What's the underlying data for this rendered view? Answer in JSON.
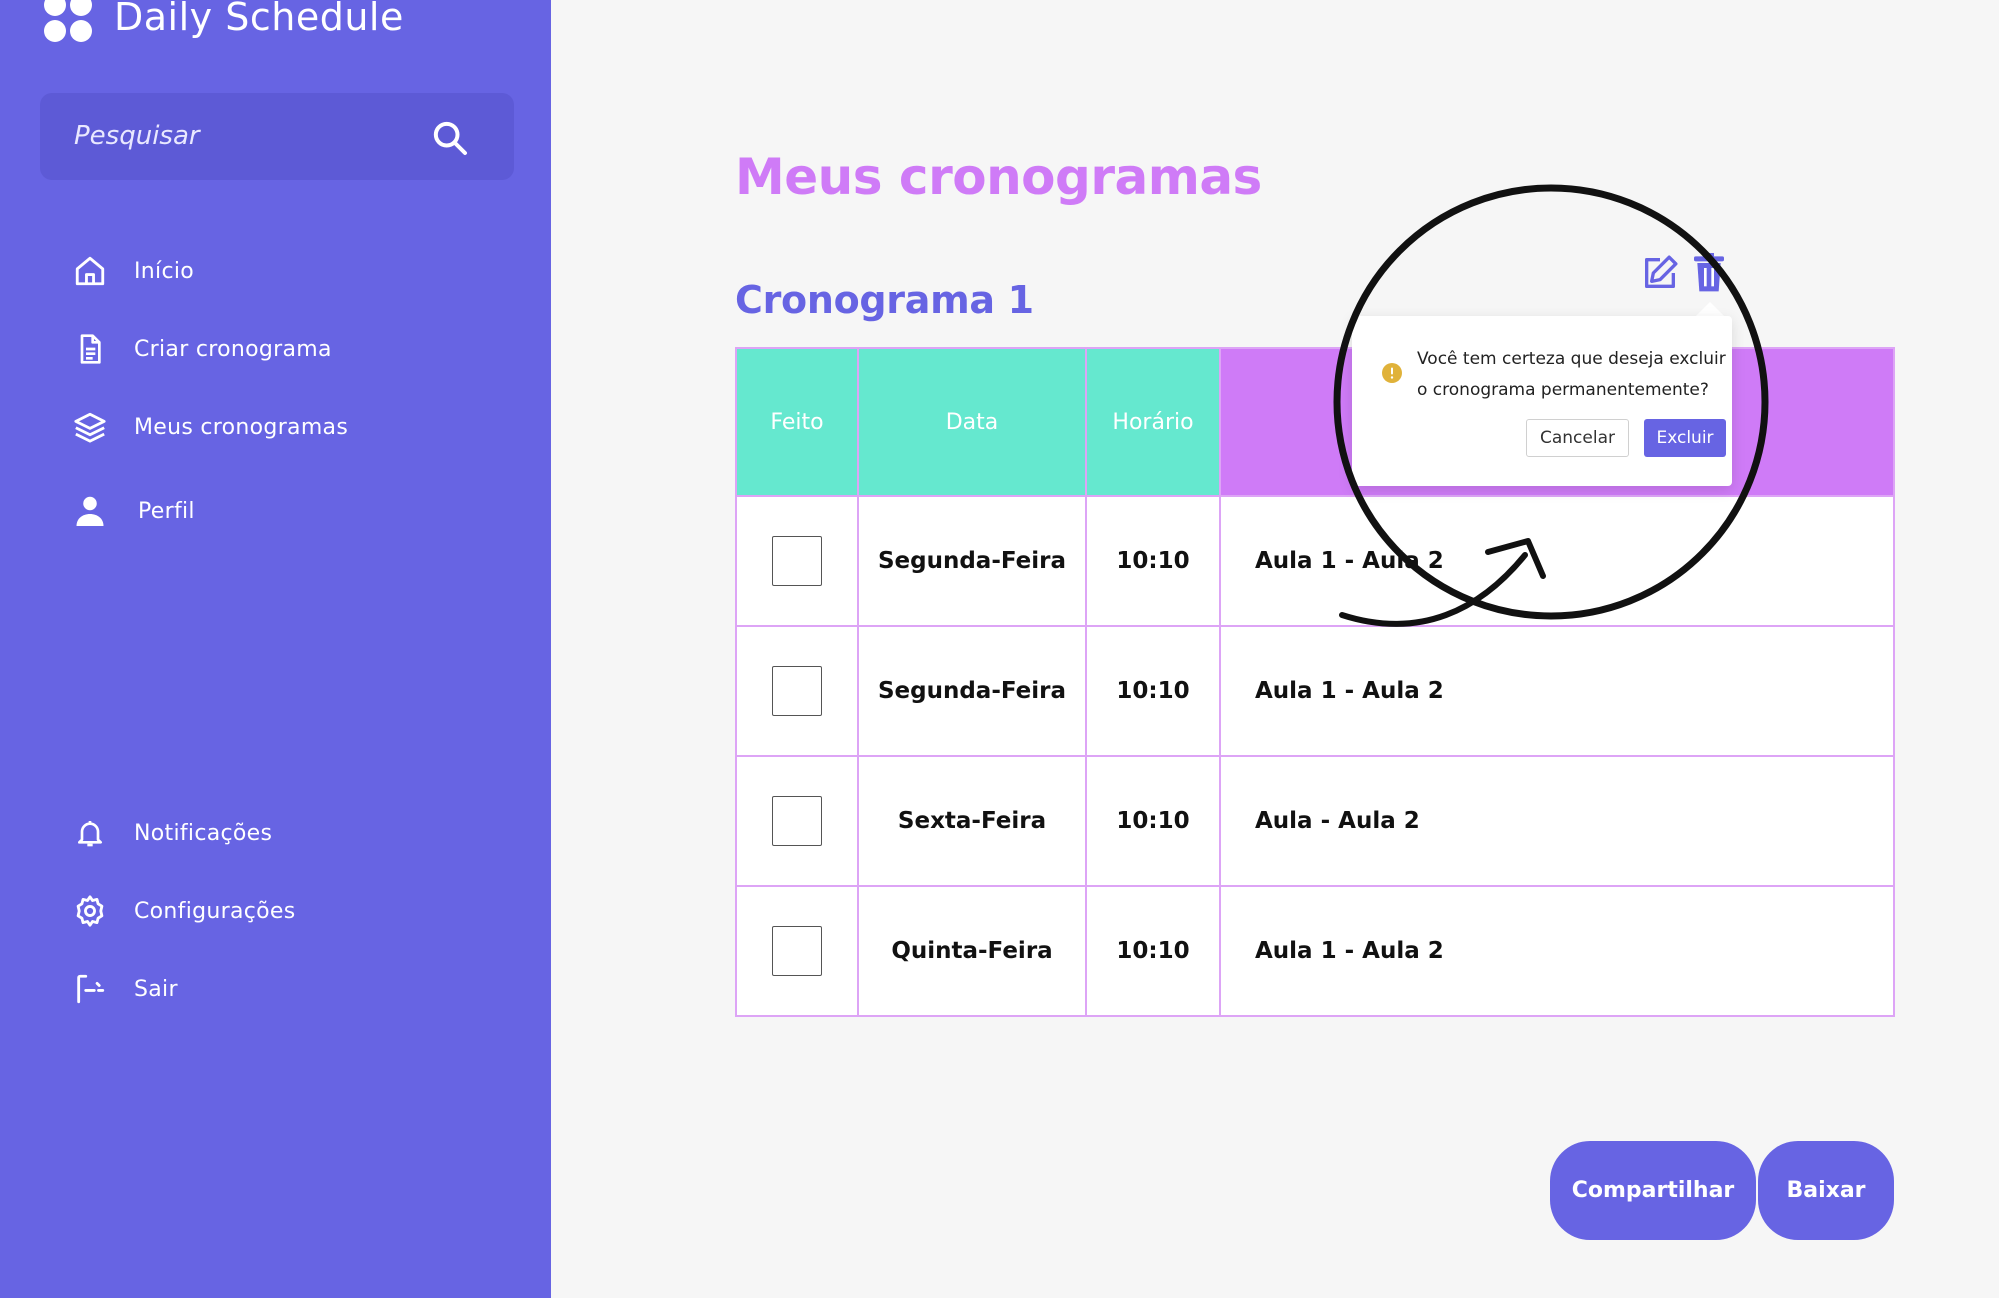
{
  "app": {
    "title": "Daily Schedule"
  },
  "search": {
    "placeholder": "Pesquisar"
  },
  "sidebar": {
    "items": [
      {
        "label": "Início",
        "icon": "home-icon"
      },
      {
        "label": "Criar cronograma",
        "icon": "document-icon"
      },
      {
        "label": "Meus cronogramas",
        "icon": "layers-icon"
      },
      {
        "label": "Perfil",
        "icon": "user-icon"
      }
    ],
    "bottom_items": [
      {
        "label": "Notificações",
        "icon": "bell-icon"
      },
      {
        "label": "Configurações",
        "icon": "gear-icon"
      },
      {
        "label": "Sair",
        "icon": "logout-icon"
      }
    ]
  },
  "main": {
    "title": "Meus cronogramas",
    "schedule_title": "Cronograma 1",
    "table": {
      "headers": [
        "Feito",
        "Data",
        "Horário",
        ""
      ],
      "rows": [
        {
          "done": false,
          "date": "Segunda-Feira",
          "time": "10:10",
          "classes": "Aula 1 - Aula 2"
        },
        {
          "done": false,
          "date": "Segunda-Feira",
          "time": "10:10",
          "classes": "Aula 1 - Aula 2"
        },
        {
          "done": false,
          "date": "Sexta-Feira",
          "time": "10:10",
          "classes": "Aula - Aula 2"
        },
        {
          "done": false,
          "date": "Quinta-Feira",
          "time": "10:10",
          "classes": "Aula 1 - Aula 2"
        }
      ]
    }
  },
  "popover": {
    "message": "Você tem certeza que deseja excluir o cronograma permanentemente?",
    "cancel_label": "Cancelar",
    "confirm_label": "Excluir"
  },
  "actions": {
    "share_label": "Compartilhar",
    "download_label": "Baixar"
  },
  "colors": {
    "sidebar": "#6764e3",
    "accent_purple": "#cf7bf7",
    "teal": "#65e8cf",
    "background": "#f6f6f6",
    "warning": "#e0b23a"
  }
}
